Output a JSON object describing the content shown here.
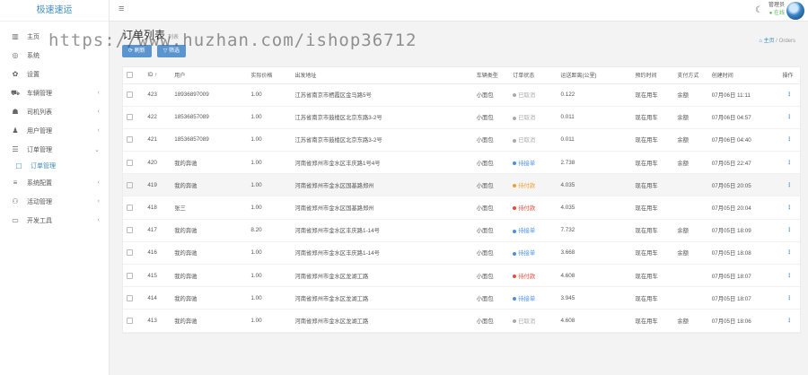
{
  "brand": "极速速运",
  "menu": [
    {
      "icon": "▥",
      "label": "主页",
      "arrow": ""
    },
    {
      "icon": "◎",
      "label": "系统",
      "arrow": ""
    },
    {
      "icon": "✿",
      "label": "设置",
      "arrow": ""
    },
    {
      "icon": "⛟",
      "label": "车辆管理",
      "arrow": "‹"
    },
    {
      "icon": "☗",
      "label": "司机列表",
      "arrow": "‹"
    },
    {
      "icon": "♟",
      "label": "用户管理",
      "arrow": "‹"
    },
    {
      "icon": "☰",
      "label": "订单管理",
      "arrow": "⌄"
    },
    {
      "icon": "☐",
      "label": "订单管理",
      "arrow": "",
      "sub": true
    },
    {
      "icon": "≡",
      "label": "系统配置",
      "arrow": "‹"
    },
    {
      "icon": "⚇",
      "label": "活动管理",
      "arrow": "‹"
    },
    {
      "icon": "▭",
      "label": "开发工具",
      "arrow": "‹"
    }
  ],
  "topbar": {
    "user": "管理员",
    "status": "● 在线"
  },
  "page": {
    "title": "订单列表",
    "subtitle": "列表",
    "breadcrumb_home": "⌂ 主页",
    "breadcrumb_sep": " / ",
    "breadcrumb_current": "Orders",
    "watermark": "https://www.huzhan.com/ishop36712"
  },
  "toolbar": {
    "refresh": "⟳ 刷新",
    "filter": "▽ 筛选"
  },
  "table": {
    "columns": [
      "",
      "ID ↑",
      "用户",
      "实际价格",
      "出发地址",
      "车辆类型",
      "订单状态",
      "运送距离(公里)",
      "预约时间",
      "支付方式",
      "创建时间",
      "操作"
    ],
    "rows": [
      [
        "423",
        "18936897009",
        "1.00",
        "江苏省南京市栖霞区金马路5号",
        "小面包",
        "已取消",
        "cancel",
        "0.122",
        "现在用车",
        "余额",
        "07月06日 11:11"
      ],
      [
        "422",
        "18536857089",
        "1.00",
        "江苏省南京市鼓楼区北京东路3-2号",
        "小面包",
        "已取消",
        "cancel",
        "0.011",
        "现在用车",
        "余额",
        "07月06日 04:57"
      ],
      [
        "421",
        "18536857089",
        "1.00",
        "江苏省南京市鼓楼区北京东路3-2号",
        "小面包",
        "已取消",
        "cancel",
        "0.011",
        "现在用车",
        "余额",
        "07月06日 04:40"
      ],
      [
        "420",
        "我的奔驰",
        "1.00",
        "河南省郑州市金水区丰庆路1号4号",
        "小面包",
        "待接单",
        "wait",
        "2.738",
        "现在用车",
        "余额",
        "07月05日 22:47"
      ],
      [
        "419",
        "我的奔驰",
        "1.00",
        "河南省郑州市金水区国基路郑州",
        "小面包",
        "待付款",
        "pay",
        "4.035",
        "现在用车",
        "",
        "07月05日 20:05"
      ],
      [
        "418",
        "张三",
        "1.00",
        "河南省郑州市金水区国基路郑州",
        "小面包",
        "待付款",
        "pick",
        "4.035",
        "现在用车",
        "",
        "07月05日 20:04"
      ],
      [
        "417",
        "我的奔驰",
        "8.20",
        "河南省郑州市金水区丰庆路1-14号",
        "小面包",
        "待接单",
        "wait",
        "7.732",
        "现在用车",
        "余额",
        "07月05日 18:09"
      ],
      [
        "416",
        "我的奔驰",
        "1.00",
        "河南省郑州市金水区丰庆路1-14号",
        "小面包",
        "待接单",
        "wait",
        "3.668",
        "现在用车",
        "余额",
        "07月05日 18:08"
      ],
      [
        "415",
        "我的奔驰",
        "1.00",
        "河南省郑州市金水区龙湖工路",
        "小面包",
        "待付款",
        "pick",
        "4.608",
        "现在用车",
        "",
        "07月05日 18:07"
      ],
      [
        "414",
        "我的奔驰",
        "1.00",
        "河南省郑州市金水区龙湖工路",
        "小面包",
        "待接单",
        "wait",
        "3.945",
        "现在用车",
        "",
        "07月05日 18:07"
      ],
      [
        "413",
        "我的奔驰",
        "1.00",
        "河南省郑州市金水区龙湖工路",
        "小面包",
        "已取消",
        "cancel",
        "4.608",
        "现在用车",
        "余额",
        "07月05日 18:06"
      ]
    ],
    "action_glyph": "⋮"
  }
}
